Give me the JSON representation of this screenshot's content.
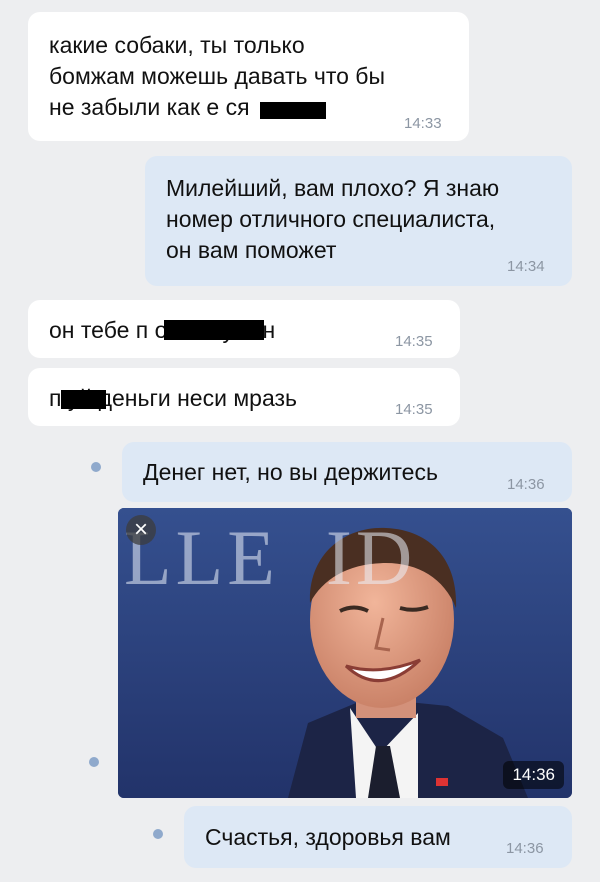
{
  "colors": {
    "background": "#edeef0",
    "incoming_bubble": "#ffffff",
    "outgoing_bubble": "#dde8f5",
    "timestamp": "#8c96a3",
    "unread_dot": "#8fa9cc"
  },
  "messages": [
    {
      "direction": "incoming",
      "text": "какие собаки, ты только\nбомжам можешь давать что бы\nне забыли как е      ся",
      "time": "14:33",
      "censored": true
    },
    {
      "direction": "outgoing",
      "text": "Милейший, вам плохо? Я знаю\nномер отличного специалиста,\nон вам поможет",
      "time": "14:34"
    },
    {
      "direction": "incoming",
      "text": "он тебе п               олке нужен",
      "time": "14:35",
      "censored": true
    },
    {
      "direction": "incoming",
      "text": "п     уй деньги неси мразь",
      "time": "14:35",
      "censored": true
    },
    {
      "direction": "outgoing",
      "text": "Денег нет, но вы держитесь",
      "time": "14:36",
      "unread": true
    },
    {
      "direction": "outgoing",
      "type": "photo",
      "time": "14:36",
      "unread": true,
      "photo_overlay_text": "LLE  ID",
      "close_icon": "close-icon"
    },
    {
      "direction": "outgoing",
      "text": "Счастья, здоровья вам",
      "time": "14:36",
      "unread": true
    }
  ]
}
